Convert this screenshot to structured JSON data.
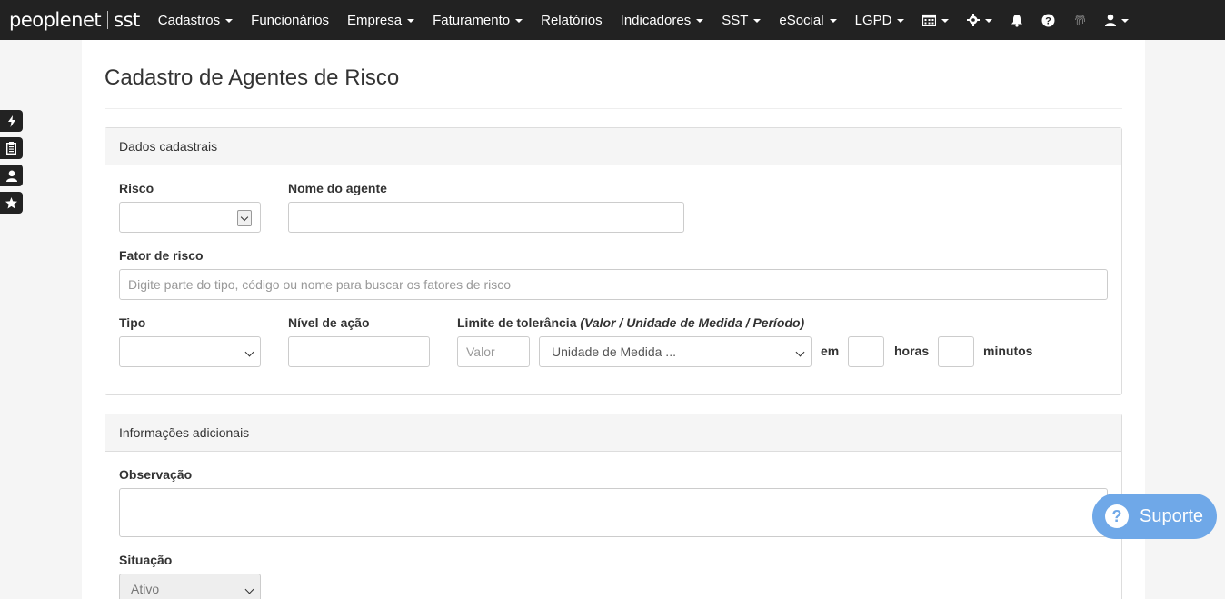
{
  "brand": {
    "part1": "peoplenet",
    "part2": "sst"
  },
  "nav": {
    "items": [
      {
        "label": "Cadastros",
        "dropdown": true
      },
      {
        "label": "Funcionários",
        "dropdown": false
      },
      {
        "label": "Empresa",
        "dropdown": true
      },
      {
        "label": "Faturamento",
        "dropdown": true
      },
      {
        "label": "Relatórios",
        "dropdown": false
      },
      {
        "label": "Indicadores",
        "dropdown": true
      },
      {
        "label": "SST",
        "dropdown": true
      },
      {
        "label": "eSocial",
        "dropdown": true
      },
      {
        "label": "LGPD",
        "dropdown": true
      }
    ],
    "icons": [
      "calendar-icon",
      "gear-icon",
      "bell-icon",
      "help-icon",
      "fingerprint-icon",
      "user-icon"
    ]
  },
  "side_buttons": [
    "bolt-icon",
    "clipboard-icon",
    "user-icon",
    "star-icon"
  ],
  "page": {
    "title": "Cadastro de Agentes de Risco"
  },
  "panel1": {
    "heading": "Dados cadastrais",
    "risco_label": "Risco",
    "risco_value": "",
    "nome_label": "Nome do agente",
    "nome_value": "",
    "fator_label": "Fator de risco",
    "fator_placeholder": "Digite parte do tipo, código ou nome para buscar os fatores de risco",
    "tipo_label": "Tipo",
    "tipo_value": "",
    "nivel_label": "Nível de ação",
    "nivel_value": "",
    "limite_label": "Limite de tolerância",
    "limite_hint": "(Valor / Unidade de Medida / Período)",
    "valor_placeholder": "Valor",
    "unidade_value": "Unidade de Medida ...",
    "em": "em",
    "horas": "horas",
    "minutos": "minutos"
  },
  "panel2": {
    "heading": "Informações adicionais",
    "obs_label": "Observação",
    "obs_value": "",
    "situacao_label": "Situação",
    "situacao_value": "Ativo"
  },
  "suporte": {
    "label": "Suporte"
  },
  "colors": {
    "navbar": "#222222",
    "suporte": "#6fa8e8"
  }
}
